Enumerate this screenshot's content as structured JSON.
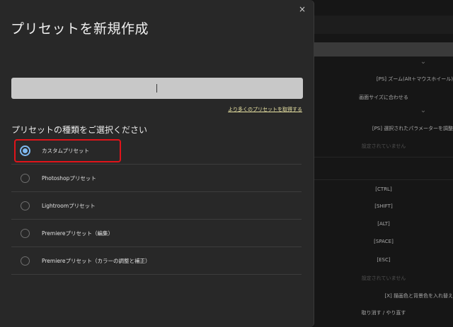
{
  "dialog": {
    "title": "プリセットを新規作成",
    "close_icon": "×",
    "name_input_value": "",
    "more_presets_link": "より多くのプリセットを取得する",
    "section_heading": "プリセットの種類をご選択ください",
    "selected_option": "カスタムプリセット",
    "options": [
      {
        "label": "カスタムプリセット",
        "checked": true
      },
      {
        "label": "Photoshopプリセット",
        "checked": false
      },
      {
        "label": "Lightroomプリセット",
        "checked": false
      },
      {
        "label": "Premiereプリセット（編集）",
        "checked": false
      },
      {
        "label": "Premiereプリセット（カラーの調整と補正）",
        "checked": false
      }
    ],
    "highlight_color": "#e0141a",
    "accent_color": "#7fb9f0"
  },
  "background": {
    "rows": [
      "[PS] ズーム(Alt＋マウスホイール)",
      "画面サイズに合わせる",
      "[PS] 選択されたパラメーターを調整",
      "設定されていません",
      "[CTRL]",
      "[SHIFT]",
      "[ALT]",
      "[SPACE]",
      "[ESC]",
      "設定されていません",
      "[X] 描画色と背景色を入れ替え",
      "取り消す / やり直す"
    ],
    "chevron_icon": "⌄"
  }
}
